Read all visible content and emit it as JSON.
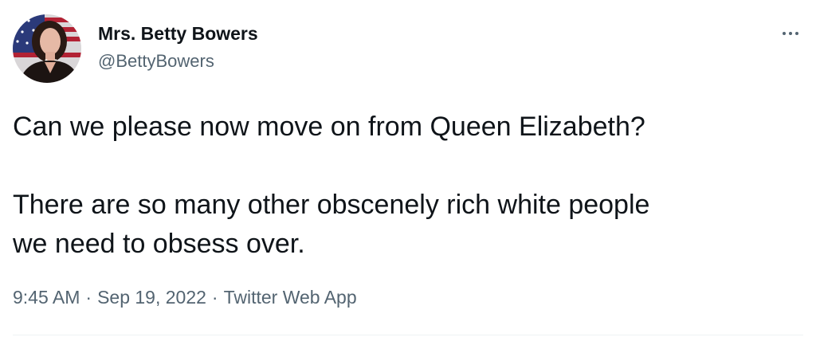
{
  "author": {
    "display_name": "Mrs. Betty Bowers",
    "handle": "@BettyBowers"
  },
  "tweet": {
    "text": "Can we please now move on from Queen Elizabeth?\n\nThere are so many other obscenely rich white people\nwe need to obsess over.",
    "time": "9:45 AM",
    "date": "Sep 19, 2022",
    "source": "Twitter Web App",
    "separator": "·"
  },
  "icons": {
    "more": "more-horizontal-icon"
  },
  "colors": {
    "text_primary": "#0f1419",
    "text_secondary": "#536471",
    "divider": "#eff3f4"
  }
}
